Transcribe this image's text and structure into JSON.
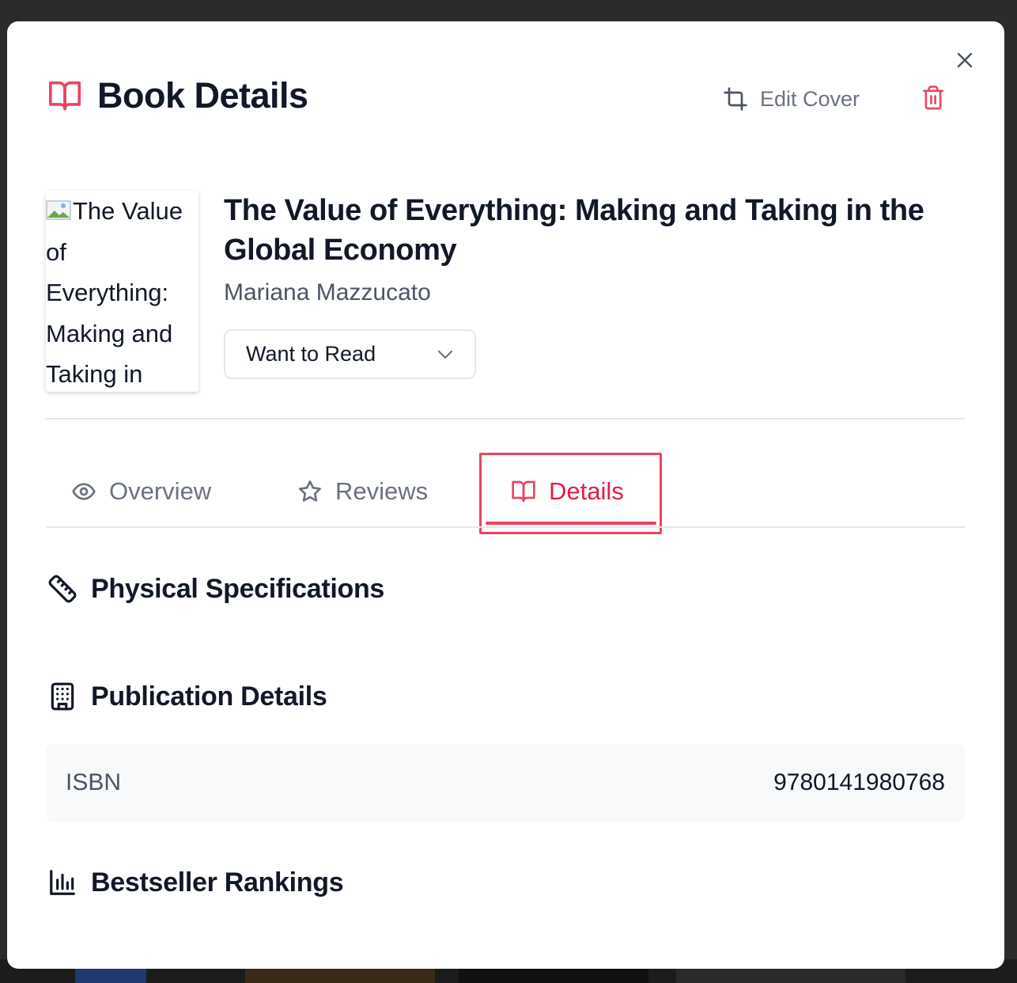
{
  "modal": {
    "title": "Book Details",
    "edit_cover_label": "Edit Cover",
    "close_icon": "close-icon",
    "trash_icon": "trash-icon",
    "accent_color": "#e11d48"
  },
  "book": {
    "cover_alt": "The Value of Everything: Making and Taking in",
    "cover_alt_lines": [
      "The Value",
      "of",
      "Everything:",
      "Making and",
      "Taking in"
    ],
    "title": "The Value of Everything: Making and Taking in the Global Economy",
    "author": "Mariana Mazzucato",
    "status": "Want to Read"
  },
  "tabs": [
    {
      "label": "Overview",
      "icon": "eye-icon",
      "active": false
    },
    {
      "label": "Reviews",
      "icon": "star-icon",
      "active": false
    },
    {
      "label": "Details",
      "icon": "book-open-icon",
      "active": true
    }
  ],
  "sections": {
    "physical": {
      "title": "Physical Specifications",
      "icon": "ruler-icon"
    },
    "publication": {
      "title": "Publication Details",
      "icon": "building-icon",
      "rows": [
        {
          "key": "ISBN",
          "value": "9780141980768"
        }
      ]
    },
    "bestseller": {
      "title": "Bestseller Rankings",
      "icon": "bar-chart-icon"
    }
  }
}
